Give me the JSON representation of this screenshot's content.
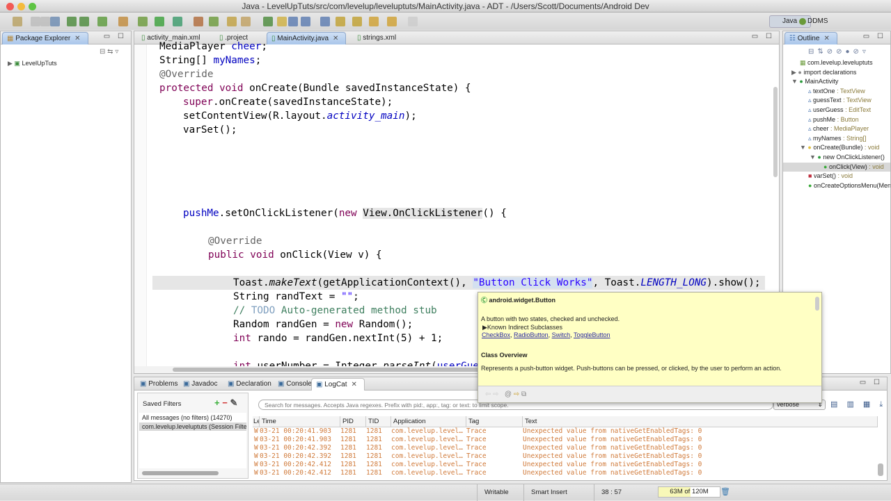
{
  "window": {
    "title": "Java - LevelUpTuts/src/com/levelup/leveluptuts/MainActivity.java - ADT - /Users/Scott/Documents/Android Dev"
  },
  "perspectives": {
    "java": "Java",
    "ddms": "DDMS"
  },
  "package_explorer": {
    "title": "Package Explorer",
    "items": [
      "LevelUpTuts"
    ]
  },
  "editor": {
    "tabs": [
      "activity_main.xml",
      ".project",
      "MainActivity.java",
      "strings.xml"
    ],
    "active_tab": 2,
    "lines": [
      {
        "indent": 1,
        "segs": [
          {
            "t": "MediaPlayer ",
            "c": ""
          },
          {
            "t": "cheer",
            "c": "fld"
          },
          {
            "t": ";",
            "c": ""
          }
        ]
      },
      {
        "indent": 1,
        "segs": [
          {
            "t": "String[] ",
            "c": ""
          },
          {
            "t": "myNames",
            "c": "fld"
          },
          {
            "t": ";",
            "c": ""
          }
        ]
      },
      {
        "indent": 1,
        "segs": [
          {
            "t": "@Override",
            "c": "ann"
          }
        ]
      },
      {
        "indent": 1,
        "segs": [
          {
            "t": "protected void ",
            "c": "kw"
          },
          {
            "t": "onCreate(Bundle savedInstanceState) {",
            "c": ""
          }
        ]
      },
      {
        "indent": 2,
        "segs": [
          {
            "t": "super",
            "c": "kw"
          },
          {
            "t": ".onCreate(savedInstanceState);",
            "c": ""
          }
        ]
      },
      {
        "indent": 2,
        "segs": [
          {
            "t": "setContentView(R.layout.",
            "c": ""
          },
          {
            "t": "activity_main",
            "c": "itf"
          },
          {
            "t": ");",
            "c": ""
          }
        ]
      },
      {
        "indent": 2,
        "segs": [
          {
            "t": "varSet();",
            "c": ""
          }
        ]
      },
      {
        "indent": 0,
        "segs": []
      },
      {
        "indent": 0,
        "segs": []
      },
      {
        "indent": 0,
        "segs": []
      },
      {
        "indent": 0,
        "segs": []
      },
      {
        "indent": 0,
        "segs": []
      },
      {
        "indent": 2,
        "segs": [
          {
            "t": "pushMe",
            "c": "fld"
          },
          {
            "t": ".setOnClickListener(",
            "c": ""
          },
          {
            "t": "new ",
            "c": "kw"
          },
          {
            "t": "View.OnClickListener",
            "c": "hl"
          },
          {
            "t": "() {",
            "c": ""
          }
        ]
      },
      {
        "indent": 0,
        "segs": []
      },
      {
        "indent": 3,
        "segs": [
          {
            "t": "@Override",
            "c": "ann"
          }
        ]
      },
      {
        "indent": 3,
        "segs": [
          {
            "t": "public void ",
            "c": "kw"
          },
          {
            "t": "onClick(View v) {",
            "c": ""
          }
        ]
      },
      {
        "indent": 0,
        "segs": []
      },
      {
        "indent": 4,
        "segs": [
          {
            "t": "Toast.",
            "c": ""
          },
          {
            "t": "makeText",
            "c": "it"
          },
          {
            "t": "(getApplicationContext(), ",
            "c": ""
          },
          {
            "t": "\"Button Click Works\"",
            "c": "str sel"
          },
          {
            "t": ", Toast.",
            "c": ""
          },
          {
            "t": "LENGTH_LONG",
            "c": "itf"
          },
          {
            "t": ").show();",
            "c": ""
          }
        ]
      },
      {
        "indent": 4,
        "segs": [
          {
            "t": "String randText = ",
            "c": ""
          },
          {
            "t": "\"\"",
            "c": "str"
          },
          {
            "t": ";",
            "c": ""
          }
        ]
      },
      {
        "indent": 4,
        "segs": [
          {
            "t": "// ",
            "c": "com"
          },
          {
            "t": "TODO",
            "c": "todo"
          },
          {
            "t": " Auto-generated method stub",
            "c": "com"
          }
        ]
      },
      {
        "indent": 4,
        "segs": [
          {
            "t": "Random randGen = ",
            "c": ""
          },
          {
            "t": "new ",
            "c": "kw"
          },
          {
            "t": "Random();",
            "c": ""
          }
        ]
      },
      {
        "indent": 4,
        "segs": [
          {
            "t": "int ",
            "c": "kw"
          },
          {
            "t": "rando = randGen.nextInt(5) + 1;",
            "c": ""
          }
        ]
      },
      {
        "indent": 0,
        "segs": []
      },
      {
        "indent": 4,
        "segs": [
          {
            "t": "int ",
            "c": "kw"
          },
          {
            "t": "userNumber = Integer.",
            "c": ""
          },
          {
            "t": "parseInt",
            "c": "it"
          },
          {
            "t": "(",
            "c": ""
          },
          {
            "t": "userGuess",
            "c": "fld"
          }
        ]
      }
    ]
  },
  "outline": {
    "title": "Outline",
    "items": [
      {
        "name": "com.levelup.leveluptuts",
        "type": "",
        "depth": 0,
        "icon": "package-icon",
        "color": "#6a9a3a"
      },
      {
        "name": "import declarations",
        "type": "",
        "depth": 0,
        "icon": "imports-icon",
        "color": "#888"
      },
      {
        "name": "MainActivity",
        "type": "",
        "depth": 0,
        "icon": "class-icon",
        "color": "#2a9a3a"
      },
      {
        "name": "textOne",
        "type": " : TextView",
        "depth": 1,
        "icon": "field-icon",
        "color": "#3a6aaa"
      },
      {
        "name": "guessText",
        "type": " : TextView",
        "depth": 1,
        "icon": "field-icon",
        "color": "#3a6aaa"
      },
      {
        "name": "userGuess",
        "type": " : EditText",
        "depth": 1,
        "icon": "field-icon",
        "color": "#3a6aaa"
      },
      {
        "name": "pushMe",
        "type": " : Button",
        "depth": 1,
        "icon": "field-icon",
        "color": "#3a6aaa"
      },
      {
        "name": "cheer",
        "type": " : MediaPlayer",
        "depth": 1,
        "icon": "field-icon",
        "color": "#3a6aaa"
      },
      {
        "name": "myNames",
        "type": " : String[]",
        "depth": 1,
        "icon": "field-icon",
        "color": "#3a6aaa"
      },
      {
        "name": "onCreate(Bundle)",
        "type": " : void",
        "depth": 1,
        "icon": "method-icon",
        "color": "#e0c040"
      },
      {
        "name": "new OnClickListener()",
        "type": "",
        "depth": 2,
        "icon": "anon-class-icon",
        "color": "#2a9a3a"
      },
      {
        "name": "onClick(View)",
        "type": " : void",
        "depth": 3,
        "icon": "method-icon",
        "color": "#3aaa3a"
      },
      {
        "name": "varSet()",
        "type": " : void",
        "depth": 1,
        "icon": "private-method-icon",
        "color": "#c03040"
      },
      {
        "name": "onCreateOptionsMenu(Menu)",
        "type": "",
        "depth": 1,
        "icon": "method-icon",
        "color": "#3aaa3a"
      }
    ]
  },
  "bottom": {
    "tabs": [
      "Problems",
      "Javadoc",
      "Declaration",
      "Console",
      "LogCat"
    ],
    "active_tab": 4,
    "saved_filters": {
      "title": "Saved Filters",
      "items": [
        "All messages (no filters) (14270)",
        "com.levelup.leveluptuts (Session Filter)"
      ]
    },
    "search_placeholder": "Search for messages. Accepts Java regexes. Prefix with pid:, app:, tag: or text: to limit scope.",
    "level_select": "verbose",
    "columns": [
      "Level",
      "Time",
      "PID",
      "TID",
      "Application",
      "Tag",
      "Text"
    ],
    "rows": [
      [
        "W",
        "03-21 00:20:41.903",
        "1281",
        "1281",
        "com.levelup.level…",
        "Trace",
        "Unexpected value from nativeGetEnabledTags: 0"
      ],
      [
        "W",
        "03-21 00:20:41.903",
        "1281",
        "1281",
        "com.levelup.level…",
        "Trace",
        "Unexpected value from nativeGetEnabledTags: 0"
      ],
      [
        "W",
        "03-21 00:20:42.392",
        "1281",
        "1281",
        "com.levelup.level…",
        "Trace",
        "Unexpected value from nativeGetEnabledTags: 0"
      ],
      [
        "W",
        "03-21 00:20:42.392",
        "1281",
        "1281",
        "com.levelup.level…",
        "Trace",
        "Unexpected value from nativeGetEnabledTags: 0"
      ],
      [
        "W",
        "03-21 00:20:42.412",
        "1281",
        "1281",
        "com.levelup.level…",
        "Trace",
        "Unexpected value from nativeGetEnabledTags: 0"
      ],
      [
        "W",
        "03-21 00:20:42.412",
        "1281",
        "1281",
        "com.levelup.level…",
        "Trace",
        "Unexpected value from nativeGetEnabledTags: 0"
      ]
    ]
  },
  "popup": {
    "title": "android.widget.Button",
    "desc": "A button with two states, checked and unchecked.",
    "subclasses_label": "Known Indirect Subclasses",
    "subclasses": [
      "CheckBox",
      "RadioButton",
      "Switch",
      "ToggleButton"
    ],
    "overview_title": "Class Overview",
    "overview": "Represents a push-button widget. Push-buttons can be pressed, or clicked, by the user to perform an action."
  },
  "status": {
    "writable": "Writable",
    "insert_mode": "Smart Insert",
    "position": "38 : 57",
    "heap": "63M of 120M",
    "heap_used_fraction": 0.525
  }
}
